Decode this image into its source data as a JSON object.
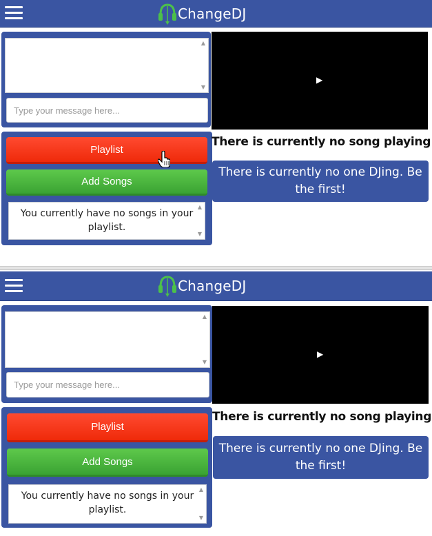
{
  "app": {
    "brand": "ChangeDJ",
    "brand_color": "#3a55a2"
  },
  "chat": {
    "placeholder": "Type your message here..."
  },
  "controls": {
    "playlist_label": "Playlist",
    "add_songs_label": "Add Songs",
    "empty_playlist_text": "You currently have no songs in your playlist.",
    "playlist_color": "#f2300f",
    "add_songs_color": "#44ad39"
  },
  "player": {
    "play_glyph": "▶",
    "now_playing_text": "There is currently no song playing",
    "dj_text": "There is currently no one DJing. Be the first!"
  },
  "icons": {
    "menu": "hamburger-icon",
    "logo": "headphones-icon",
    "cursor": "hand-pointer-icon"
  }
}
